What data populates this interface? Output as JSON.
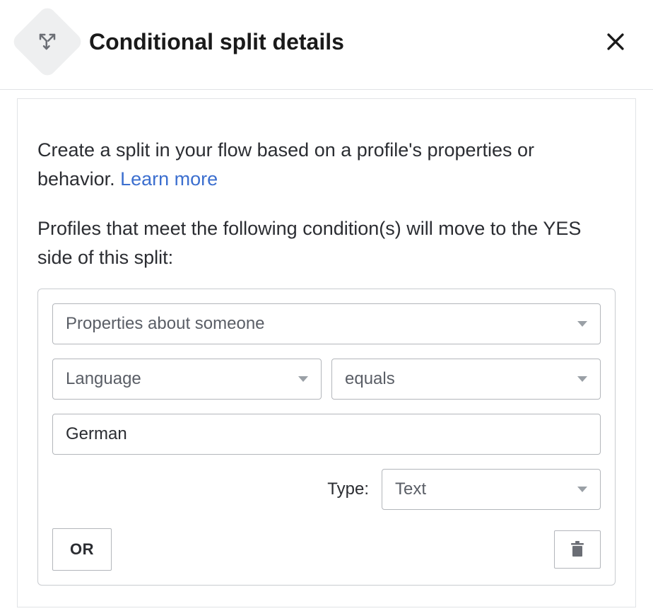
{
  "header": {
    "title": "Conditional split details"
  },
  "intro": {
    "text_prefix": "Create a split in your flow based on a profile's properties or behavior. ",
    "learn_more": "Learn more"
  },
  "subheading": "Profiles that meet the following condition(s) will move to the YES side of this split:",
  "condition": {
    "conditionType": "Properties about someone",
    "property": "Language",
    "operator": "equals",
    "value": "German",
    "typeLabel": "Type:",
    "valueType": "Text"
  },
  "actions": {
    "or_label": "OR"
  }
}
